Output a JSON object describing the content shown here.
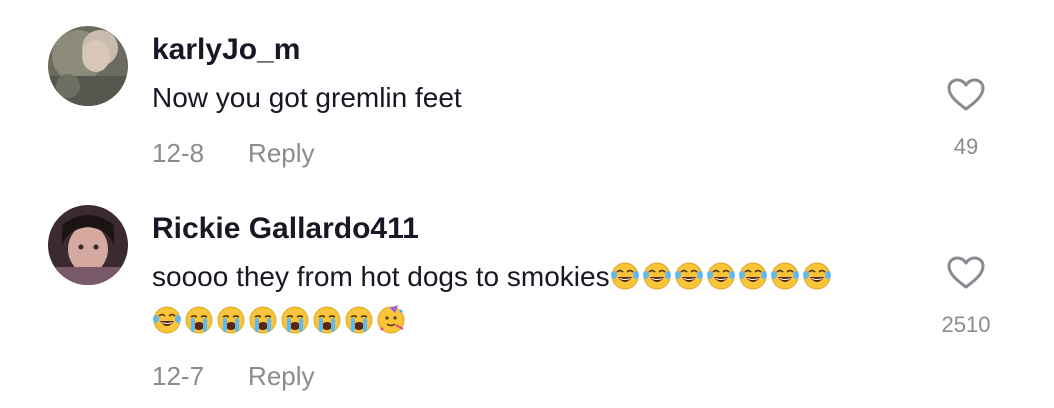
{
  "comments": [
    {
      "username": "karlyJo_m",
      "text": "Now you got gremlin feet",
      "emojis_line1": [],
      "emojis_line2": [],
      "date": "12-8",
      "reply_label": "Reply",
      "likes": "49",
      "avatar_icon": "avatar-photo"
    },
    {
      "username": "Rickie Gallardo411",
      "text": "soooo they from hot dogs to smokies",
      "emojis_line1": [
        "laughing-tears",
        "laughing-tears",
        "laughing-tears",
        "laughing-tears",
        "laughing-tears",
        "laughing-tears",
        "laughing-tears"
      ],
      "emojis_line2": [
        "laughing-tears",
        "crying",
        "crying",
        "crying",
        "crying",
        "crying",
        "crying",
        "partying-face"
      ],
      "date": "12-7",
      "reply_label": "Reply",
      "likes": "2510",
      "avatar_icon": "avatar-photo"
    }
  ],
  "colors": {
    "text": "#161823",
    "muted": "#8a8b91",
    "heart": "#8a8b91"
  }
}
